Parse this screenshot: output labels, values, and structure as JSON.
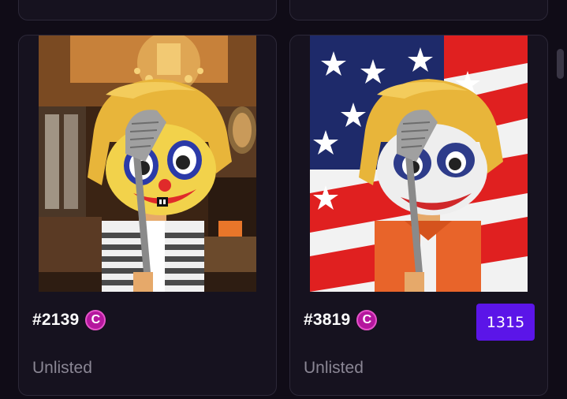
{
  "cards": [
    {
      "token_id": "#2139",
      "collection_badge": "C",
      "status": "Unlisted",
      "background": "ornate-room",
      "face": "clown"
    },
    {
      "token_id": "#3819",
      "collection_badge": "C",
      "rank": "1315",
      "status": "Unlisted",
      "background": "american-flag",
      "face": "joker"
    }
  ],
  "colors": {
    "page_bg": "#100c17",
    "card_bg": "#16121f",
    "card_border": "#2c2838",
    "badge_magenta": "#b5179e",
    "rank_purple": "#5b15e8",
    "status_gray": "#8a8694"
  },
  "icons": [
    "collection-c-icon",
    "golf-club-icon"
  ]
}
